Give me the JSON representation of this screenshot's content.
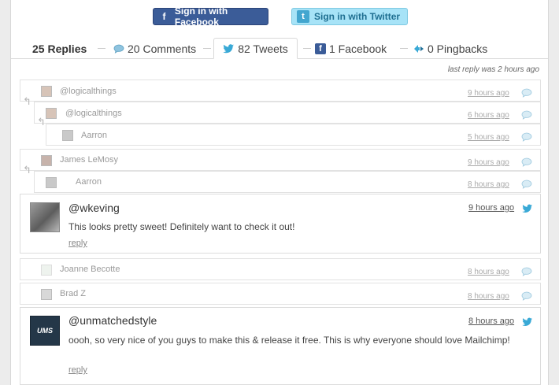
{
  "signin": {
    "facebook_label": "Sign in with Facebook",
    "twitter_label": "Sign in with Twitter"
  },
  "tabs": {
    "replies": "25 Replies",
    "comments": "20 Comments",
    "tweets": "82 Tweets",
    "facebook": "1 Facebook",
    "pingbacks": "0 Pingbacks"
  },
  "last_reply": "last reply was 2 hours ago",
  "collapsed": [
    {
      "name": "@logicalthings",
      "time": "9 hours ago",
      "type": "comment"
    },
    {
      "name": "@logicalthings",
      "time": "6 hours ago",
      "type": "comment"
    },
    {
      "name": "Aarron",
      "time": "5 hours ago",
      "type": "comment"
    },
    {
      "name": "James LeMosy",
      "time": "9 hours ago",
      "type": "comment"
    },
    {
      "name": "Aarron",
      "time": "8 hours ago",
      "type": "comment"
    },
    {
      "name": "Joanne Becotte",
      "time": "8 hours ago",
      "type": "comment"
    },
    {
      "name": "Brad Z",
      "time": "8 hours ago",
      "type": "comment"
    }
  ],
  "expanded": [
    {
      "name": "@wkeving",
      "time": "9 hours ago",
      "text": "This looks pretty sweet! Definitely want to check it out!",
      "reply": "reply",
      "type": "tweet"
    },
    {
      "name": "@unmatchedstyle",
      "time": "8 hours ago",
      "text": "oooh, so very nice of you guys to make this & release it free. This is why everyone should love Mailchimp!",
      "reply": "reply",
      "avatar_text": "UMS",
      "type": "tweet"
    }
  ],
  "colors": {
    "facebook": "#3b5c98",
    "twitter_button": "#a7e3f7",
    "twitter_bird": "#39a9d6",
    "comment_bubble": "#8fc4df"
  }
}
